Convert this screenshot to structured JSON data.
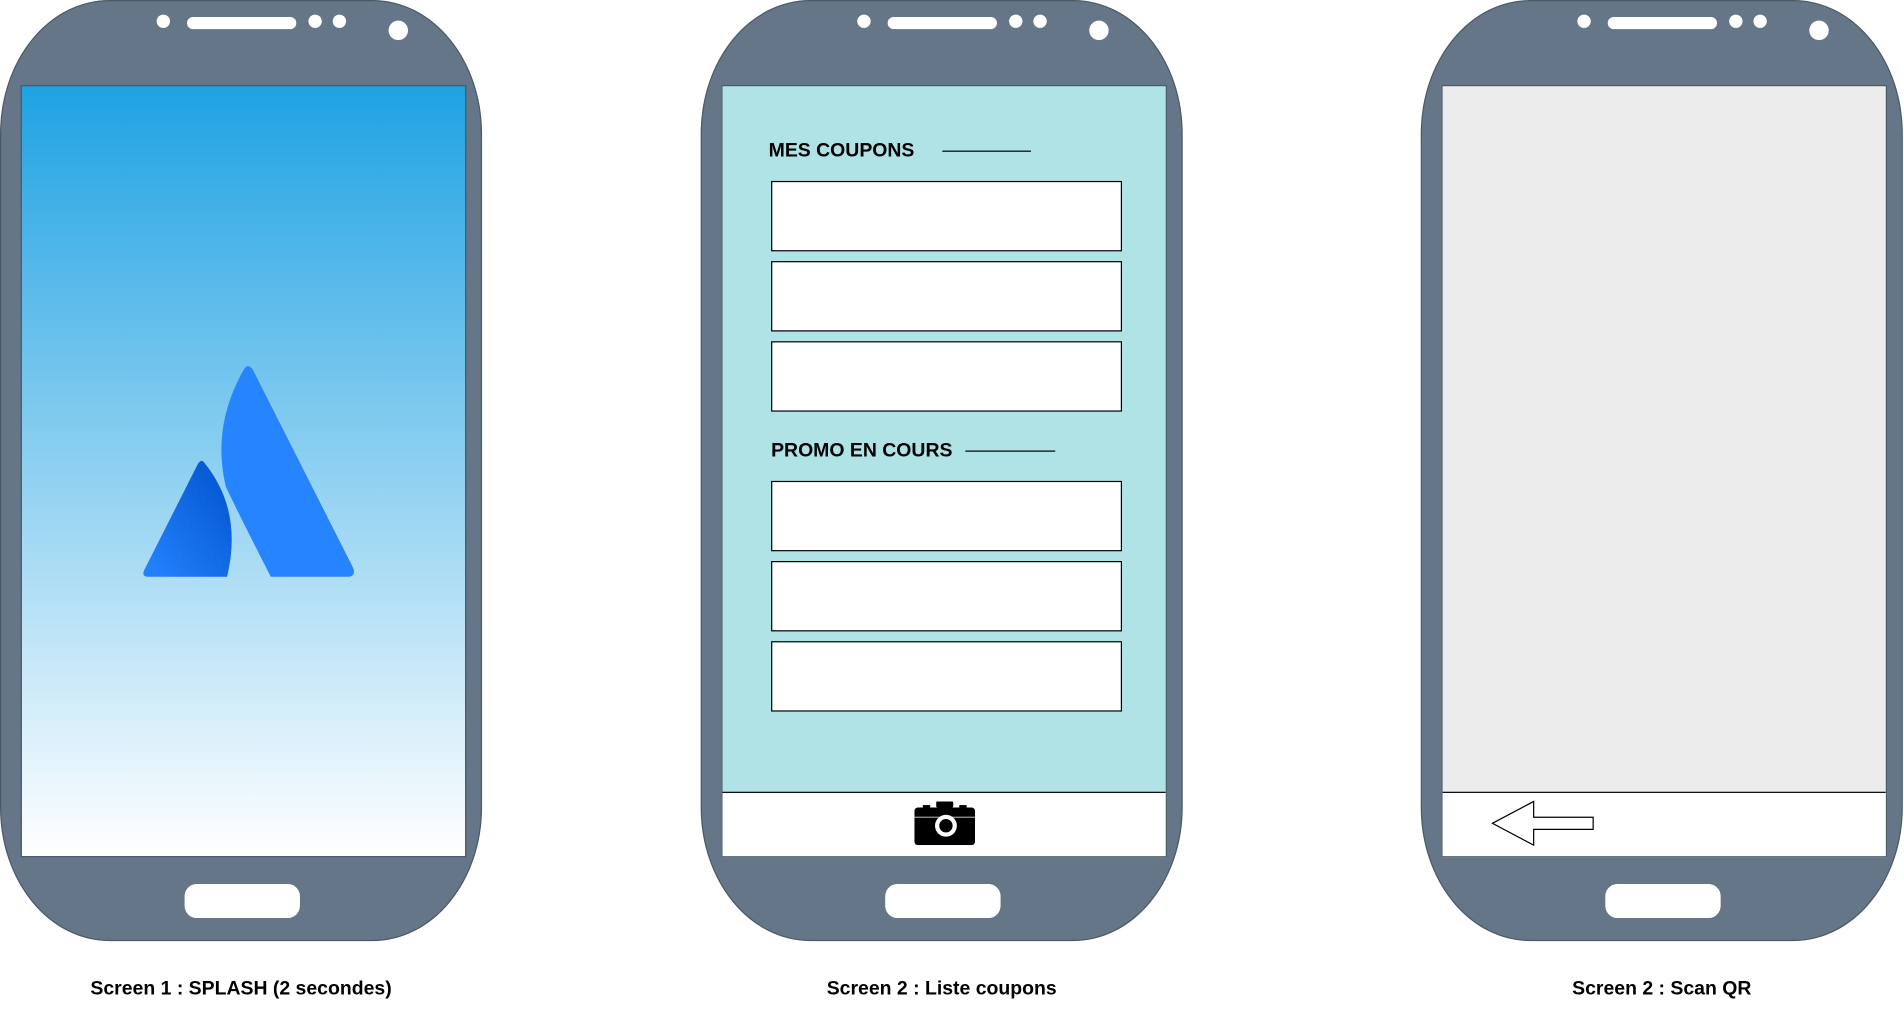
{
  "screens": [
    {
      "caption": "Screen 1 : SPLASH (2 secondes)",
      "gradient": [
        "#1fa2e3",
        "#ffffff"
      ],
      "logo": "atlassian-logo-icon",
      "logo_color": "#2684ff"
    },
    {
      "caption": "Screen 2 : Liste coupons",
      "background": "#b0e3e6",
      "sections": [
        {
          "title": "MES COUPONS",
          "items": 3
        },
        {
          "title": "PROMO EN COURS",
          "items": 3
        }
      ],
      "bottom_icon": "camera-icon"
    },
    {
      "caption": "Screen 2 : Scan QR",
      "background": "#ececec",
      "bottom_icon": "back-arrow-icon"
    }
  ],
  "colors": {
    "phone_body": "#647687"
  }
}
